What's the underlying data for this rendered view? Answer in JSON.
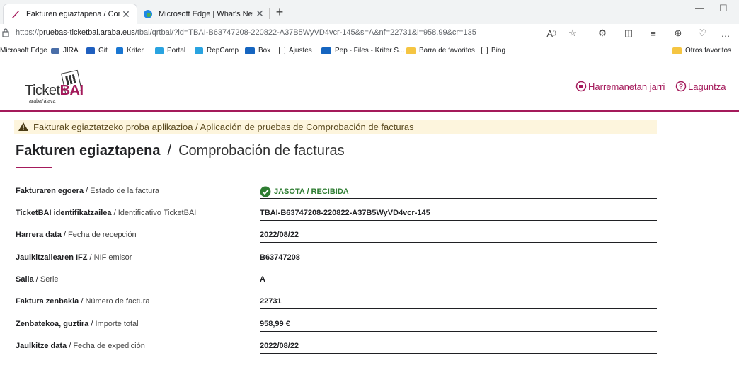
{
  "browser": {
    "tabs": [
      {
        "title": "Fakturen egiaztapena / Comprob",
        "active": true
      },
      {
        "title": "Microsoft Edge | What's New",
        "active": false
      }
    ],
    "url_prefix": "https://",
    "url_host": "pruebas-ticketbai.araba.eus",
    "url_path": "/tbai/qrtbai/?id=TBAI-B63747208-220822-A37B5WyVD4vcr-145&s=A&nf=22731&i=958.99&cr=135",
    "bookmarks": [
      {
        "label": "Microsoft Edge",
        "icon": "folder-icon"
      },
      {
        "label": "JIRA",
        "icon": "jira-icon"
      },
      {
        "label": "Git",
        "icon": "git-icon"
      },
      {
        "label": "Kriter",
        "icon": "kriter-icon"
      },
      {
        "label": "Portal",
        "icon": "portal-icon"
      },
      {
        "label": "RepCamp",
        "icon": "portal-icon"
      },
      {
        "label": "Box",
        "icon": "sharepoint-icon"
      },
      {
        "label": "Ajustes",
        "icon": "page-icon"
      },
      {
        "label": "Pep - Files - Kriter S...",
        "icon": "sharepoint-icon"
      },
      {
        "label": "Barra de favoritos",
        "icon": "folder-icon"
      },
      {
        "label": "Bing",
        "icon": "page-icon"
      }
    ],
    "other_favorites": "Otros favoritos"
  },
  "header": {
    "logo_text_plain": "Ticket",
    "logo_text_bold": "BAI",
    "logo_sub": "araba*álava",
    "contact_link": "Harremanetan jarri",
    "help_link": "Laguntza"
  },
  "notice": "Fakturak egiaztatzeko proba aplikazioa / Aplicación de pruebas de Comprobación de facturas",
  "title": {
    "eu": "Fakturen egiaztapena",
    "sep": "/",
    "es": "Comprobación de facturas"
  },
  "fields": [
    {
      "label_eu": "Fakturaren egoera",
      "label_es": "Estado de la factura",
      "value": "JASOTA / RECIBIDA"
    },
    {
      "label_eu": "TicketBAI identifikatzailea",
      "label_es": "Identificativo TicketBAI",
      "value": "TBAI-B63747208-220822-A37B5WyVD4vcr-145"
    },
    {
      "label_eu": "Harrera data",
      "label_es": "Fecha de recepción",
      "value": "2022/08/22"
    },
    {
      "label_eu": "Jaulkitzailearen IFZ",
      "label_es": "NIF emisor",
      "value": "B63747208"
    },
    {
      "label_eu": "Saila",
      "label_es": "Serie",
      "value": "A"
    },
    {
      "label_eu": "Faktura zenbakia",
      "label_es": "Número de factura",
      "value": "22731"
    },
    {
      "label_eu": "Zenbatekoa, guztira",
      "label_es": "Importe total",
      "value": "958,99 €"
    },
    {
      "label_eu": "Jaulkitze data",
      "label_es": "Fecha de expedición",
      "value": "2022/08/22"
    }
  ],
  "colors": {
    "brand": "#a41a5b",
    "status_ok": "#2e7d32",
    "notice_bg": "#fdf5dd"
  },
  "label_separator": " / "
}
